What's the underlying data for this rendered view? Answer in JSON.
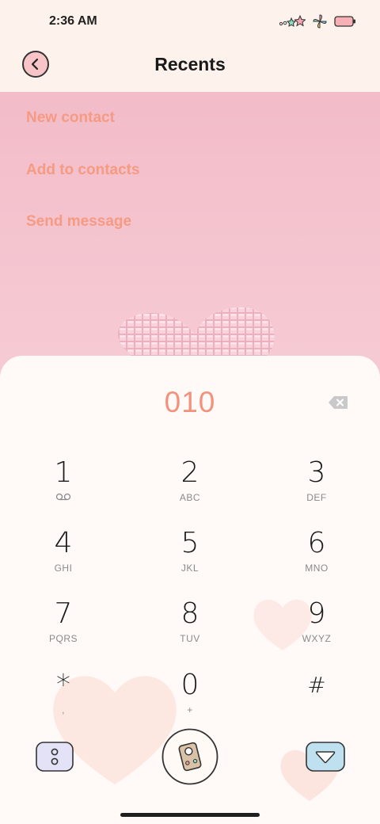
{
  "status": {
    "time": "2:36 AM"
  },
  "header": {
    "title": "Recents"
  },
  "menu": {
    "items": [
      {
        "label": "New contact"
      },
      {
        "label": "Add to contacts"
      },
      {
        "label": "Send message"
      }
    ]
  },
  "dialer": {
    "number": "010",
    "keys": [
      {
        "digit": "1",
        "letters": ""
      },
      {
        "digit": "2",
        "letters": "ABC"
      },
      {
        "digit": "3",
        "letters": "DEF"
      },
      {
        "digit": "4",
        "letters": "GHI"
      },
      {
        "digit": "5",
        "letters": "JKL"
      },
      {
        "digit": "6",
        "letters": "MNO"
      },
      {
        "digit": "7",
        "letters": "PQRS"
      },
      {
        "digit": "8",
        "letters": "TUV"
      },
      {
        "digit": "9",
        "letters": "WXYZ"
      },
      {
        "digit": "*",
        "letters": ","
      },
      {
        "digit": "0",
        "letters": "+"
      },
      {
        "digit": "#",
        "letters": ""
      }
    ]
  },
  "colors": {
    "accent": "#f2927c",
    "menu_text": "#f59a83",
    "menu_bg": "#f3bfca",
    "header_bg": "#fdf2ec"
  },
  "icons": {
    "back": "chevron-left-icon",
    "backspace": "backspace-icon",
    "voicemail": "voicemail-icon",
    "more": "more-dots-icon",
    "call": "call-icon",
    "hide_keypad": "hide-keypad-icon"
  }
}
